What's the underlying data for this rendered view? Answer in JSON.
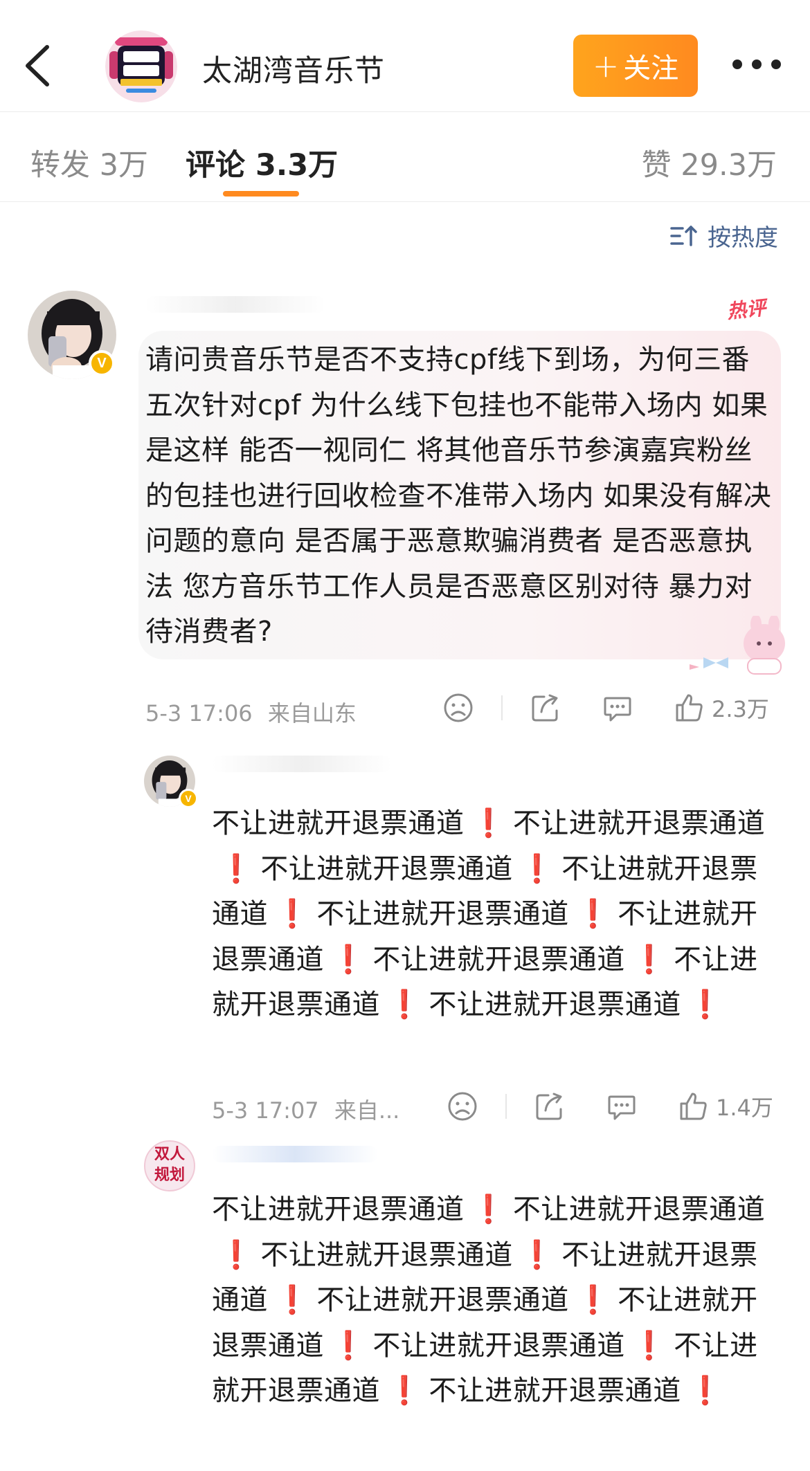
{
  "header": {
    "account_name": "太湖湾音乐节",
    "follow_label": "关注",
    "follow_plus": "+"
  },
  "tabs": {
    "repost": "转发 3万",
    "comments": "评论 3.3万",
    "likes": "赞 29.3万"
  },
  "sort_label": "按热度",
  "main_comment": {
    "hot_tag": "热评",
    "text": "请问贵音乐节是否不支持cpf线下到场，为何三番五次针对cpf 为什么线下包挂也不能带入场内 如果是这样 能否一视同仁 将其他音乐节参演嘉宾粉丝的包挂也进行回收检查不准带入场内 如果没有解决问题的意向 是否属于恶意欺骗消费者 是否恶意执法 您方音乐节工作人员是否恶意区别对待 暴力对待消费者?",
    "time": "5-3 17:06",
    "location": "来自山东",
    "like_count": "2.3万"
  },
  "reply_segment": "不让进就开退票通道",
  "reply_marker": "❗",
  "replies": [
    {
      "time": "5-3 17:07",
      "location": "来自...",
      "like_count": "1.4万"
    },
    {
      "avatar_text_1": "双人",
      "avatar_text_2": "规划"
    }
  ],
  "colors": {
    "accent": "#ff8a1f",
    "link_blue": "#4a6590",
    "hot_red": "#f0475c",
    "exclaim_red": "#d7161f"
  }
}
